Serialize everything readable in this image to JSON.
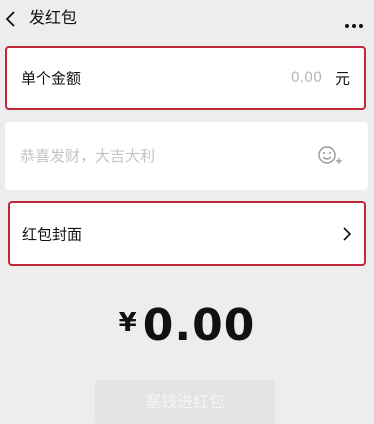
{
  "header": {
    "title": "发红包",
    "back_icon": "chevron-left-icon",
    "more_icon": "more-dots-icon"
  },
  "amount_row": {
    "label": "单个金额",
    "value": "0.00",
    "unit": "元"
  },
  "blessing": {
    "placeholder": "恭喜发财，大吉大利",
    "emoji_icon": "emoji-icon"
  },
  "cover_row": {
    "label": "红包封面",
    "chevron_icon": "chevron-right-icon"
  },
  "total": {
    "currency": "¥",
    "amount": "0.00"
  },
  "submit": {
    "label": "塞钱进红包"
  },
  "colors": {
    "background": "#ededed",
    "card": "#ffffff",
    "highlight_border": "#c0273a",
    "button_disabled": "#e3e3e3"
  }
}
